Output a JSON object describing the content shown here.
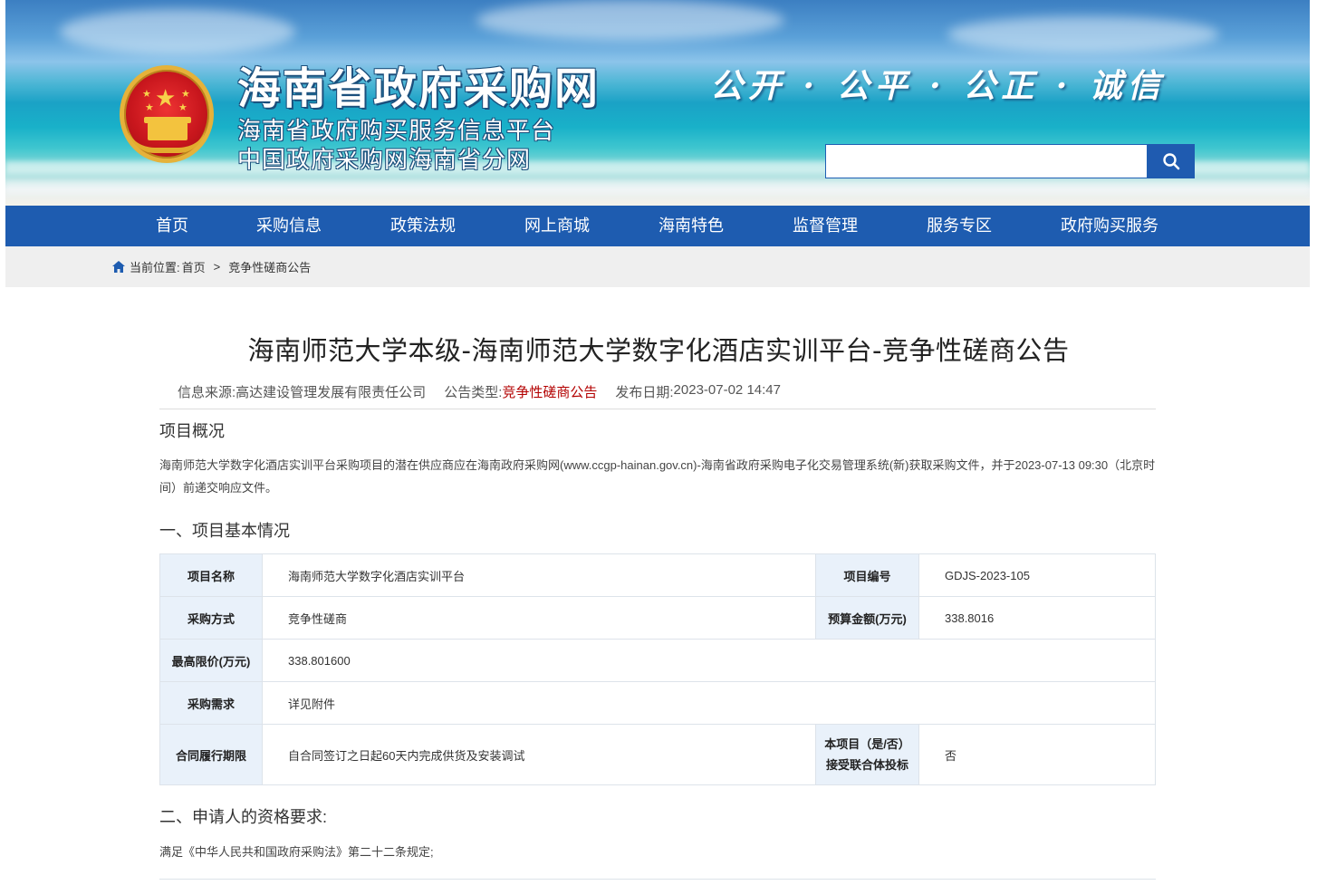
{
  "header": {
    "site_title": "海南省政府采购网",
    "subtitle_1": "海南省政府购买服务信息平台",
    "subtitle_2": "中国政府采购网海南省分网",
    "slogan": "公开 · 公平 · 公正 · 诚信",
    "search": {
      "value": "",
      "placeholder": ""
    },
    "icons": {
      "emblem": "national-emblem-icon",
      "search": "search-icon"
    }
  },
  "nav": {
    "items": [
      "首页",
      "采购信息",
      "政策法规",
      "网上商城",
      "海南特色",
      "监督管理",
      "服务专区",
      "政府购买服务"
    ]
  },
  "breadcrumb": {
    "label": "当前位置:",
    "home": "首页",
    "separator": ">",
    "current": "竞争性磋商公告"
  },
  "article": {
    "title": "海南师范大学本级-海南师范大学数字化酒店实训平台-竞争性磋商公告",
    "meta": {
      "source_label": "信息来源:",
      "source_value": "高达建设管理发展有限责任公司",
      "type_label": "公告类型:",
      "type_value": "竞争性磋商公告",
      "date_label": "发布日期:",
      "date_value": "2023-07-02 14:47"
    },
    "overview_heading": "项目概况",
    "overview_text": "海南师范大学数字化酒店实训平台采购项目的潜在供应商应在海南政府采购网(www.ccgp-hainan.gov.cn)-海南省政府采购电子化交易管理系统(新)获取采购文件，并于2023-07-13 09:30（北京时间）前递交响应文件。",
    "section1_heading": "一、项目基本情况",
    "table": {
      "project_name_label": "项目名称",
      "project_name": "海南师范大学数字化酒店实训平台",
      "project_no_label": "项目编号",
      "project_no": "GDJS-2023-105",
      "method_label": "采购方式",
      "method": "竞争性磋商",
      "budget_label": "预算金额(万元)",
      "budget": "338.8016",
      "max_price_label": "最高限价(万元)",
      "max_price": "338.801600",
      "requirement_label": "采购需求",
      "requirement": "详见附件",
      "period_label": "合同履行期限",
      "period": "自合同签订之日起60天内完成供货及安装调试",
      "joint_label_1": "本项目（是/否）",
      "joint_label_2": "接受联合体投标",
      "joint": "否"
    },
    "section2_heading": "二、申请人的资格要求:",
    "section2_text": "满足《中华人民共和国政府采购法》第二十二条规定;"
  },
  "colors": {
    "nav_blue": "#1e5cb0",
    "table_header_bg": "#e9f1fa",
    "accent_red": "#b30000"
  }
}
